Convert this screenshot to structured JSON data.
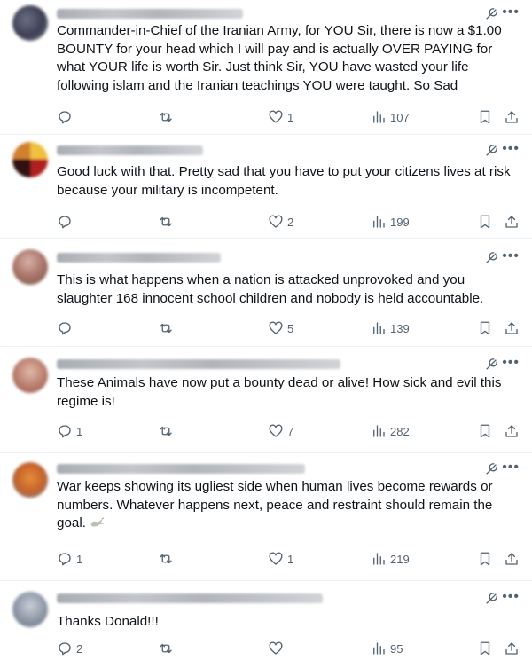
{
  "posts": [
    {
      "text": "Commander-in-Chief of the Iranian Army, for YOU Sir, there is now a $1.00 BOUNTY for your head which I will pay and is actually OVER PAYING for what YOUR life is worth Sir. Just think Sir, YOU have wasted your life following islam and the Iranian teachings YOU were taught. So Sad",
      "replies": "",
      "reposts": "",
      "likes": "1",
      "views": "107"
    },
    {
      "text": "Good luck with that. Pretty sad that you have to put your citizens lives at risk because your military is incompetent.",
      "replies": "",
      "reposts": "",
      "likes": "2",
      "views": "199"
    },
    {
      "text": "This is what happens when a nation is attacked unprovoked and you slaughter 168 innocent school children and nobody is held accountable.",
      "replies": "",
      "reposts": "",
      "likes": "5",
      "views": "139"
    },
    {
      "text": "These Animals have now put a bounty dead or alive! How sick and evil this regime is!",
      "replies": "1",
      "reposts": "",
      "likes": "7",
      "views": "282"
    },
    {
      "text": "War keeps showing its ugliest side when human lives become rewards or numbers. Whatever happens next, peace and restraint should remain the goal.",
      "replies": "1",
      "reposts": "",
      "likes": "1",
      "views": "219"
    },
    {
      "text": "Thanks Donald!!!",
      "replies": "2",
      "reposts": "",
      "likes": "",
      "views": "95"
    }
  ],
  "colors": {
    "text": "#0f1419",
    "secondary": "#536471",
    "divider": "#eff3f4"
  },
  "icons": {
    "reply": "reply-icon",
    "repost": "repost-icon",
    "like": "heart-icon",
    "views": "views-icon",
    "bookmark": "bookmark-icon",
    "share": "share-icon",
    "grok": "grok-icon",
    "more": "more-icon",
    "emoji": "dove-emoji"
  }
}
